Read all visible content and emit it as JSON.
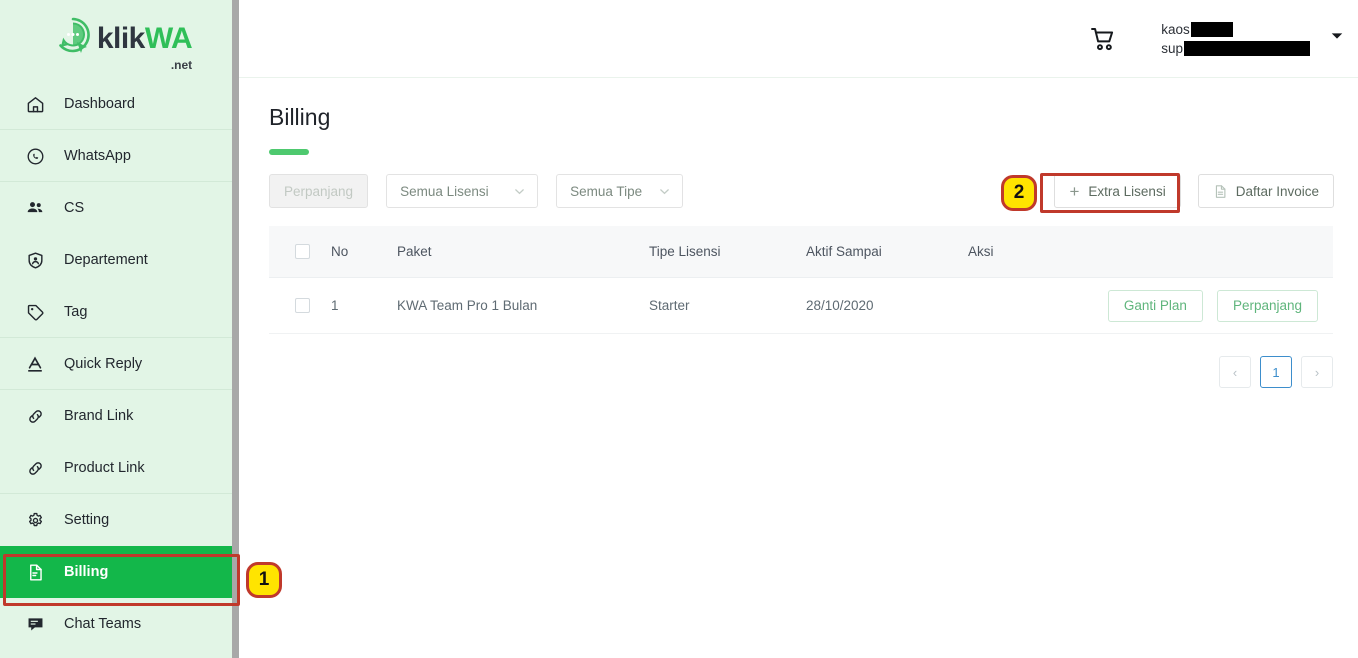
{
  "brand": {
    "name_dark": "klik",
    "name_green": "WA",
    "suffix": ".net",
    "logo_icon": "whatsapp-chat-cursor-logo"
  },
  "sidebar": {
    "items": [
      {
        "label": "Dashboard",
        "icon": "home-icon",
        "active": false
      },
      {
        "label": "WhatsApp",
        "icon": "whatsapp-icon",
        "active": false
      },
      {
        "label": "CS",
        "icon": "users-icon",
        "active": false
      },
      {
        "label": "Departement",
        "icon": "shield-user-icon",
        "active": false
      },
      {
        "label": "Tag",
        "icon": "tag-icon",
        "active": false
      },
      {
        "label": "Quick Reply",
        "icon": "letter-a-icon",
        "active": false
      },
      {
        "label": "Brand Link",
        "icon": "link-icon",
        "active": false
      },
      {
        "label": "Product Link",
        "icon": "link-icon",
        "active": false
      },
      {
        "label": "Setting",
        "icon": "gear-icon",
        "active": false
      },
      {
        "label": "Billing",
        "icon": "file-billing-icon",
        "active": true
      },
      {
        "label": "Chat Teams",
        "icon": "chat-teams-icon",
        "active": false
      }
    ],
    "active_bg": "#13b74a",
    "background": "#e2f5e6"
  },
  "topbar": {
    "cart_icon": "shopping-cart-icon",
    "user_line1": "kaos",
    "user_line2": "sup",
    "caret_icon": "chevron-down-icon"
  },
  "page": {
    "title": "Billing",
    "accent_color": "#4ec96f"
  },
  "toolbar": {
    "renew_label": "Perpanjang",
    "license_filter": "Semua Lisensi",
    "type_filter": "Semua Tipe",
    "extra_license_label": "Extra Lisensi",
    "extra_license_plus": "+",
    "invoice_list_label": "Daftar Invoice",
    "invoice_icon": "file-text-icon"
  },
  "annotations": [
    {
      "badge": "1",
      "target": "sidebar-item-billing"
    },
    {
      "badge": "2",
      "target": "extra-license-button"
    }
  ],
  "table": {
    "columns": [
      "No",
      "Paket",
      "Tipe Lisensi",
      "Aktif Sampai",
      "Aksi"
    ],
    "rows": [
      {
        "no": "1",
        "paket": "KWA Team Pro 1 Bulan",
        "tipe": "Starter",
        "aktif_sampai": "28/10/2020",
        "actions": [
          "Ganti Plan",
          "Perpanjang"
        ]
      }
    ]
  },
  "pagination": {
    "prev": "‹",
    "pages": [
      "1"
    ],
    "next": "›",
    "current": "1"
  }
}
